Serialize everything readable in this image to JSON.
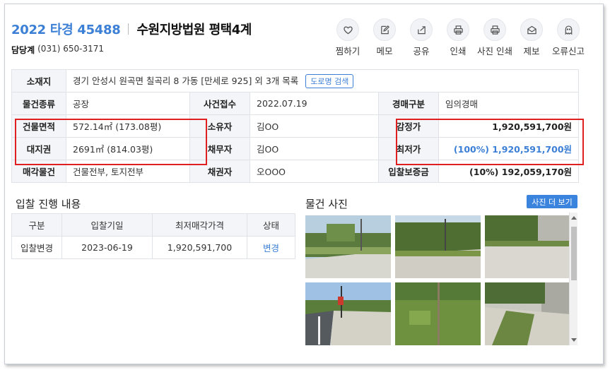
{
  "header": {
    "case_no": "2022 타경 45488",
    "court": "수원지방법원 평택4계",
    "dept_label": "담당계",
    "phone": "(031) 650-3171"
  },
  "actions": [
    {
      "label": "찜하기",
      "icon": "heart-icon"
    },
    {
      "label": "메모",
      "icon": "memo-icon"
    },
    {
      "label": "공유",
      "icon": "share-icon"
    },
    {
      "label": "인쇄",
      "icon": "print-icon"
    },
    {
      "label": "사진 인쇄",
      "icon": "photo-print-icon"
    },
    {
      "label": "제보",
      "icon": "report-icon"
    },
    {
      "label": "오류신고",
      "icon": "error-report-icon"
    }
  ],
  "info": {
    "location_label": "소재지",
    "location_value": "경기 안성시 원곡면 칠곡리 8 가동 [만세로 925] 외 3개 목록",
    "road_search": "도로명 검색",
    "type_label": "물건종류",
    "type_value": "공장",
    "case_recv_label": "사건접수",
    "case_recv_value": "2022.07.19",
    "auction_type_label": "경매구분",
    "auction_type_value": "임의경매",
    "bldg_area_label": "건물면적",
    "bldg_area_value": "572.14㎡ (173.08평)",
    "owner_label": "소유자",
    "owner_value": "김OO",
    "appraisal_label": "감정가",
    "appraisal_value": "1,920,591,700원",
    "land_label": "대지권",
    "land_value": "2691㎡ (814.03평)",
    "debtor_label": "채무자",
    "debtor_value": "김OO",
    "min_price_label": "최저가",
    "min_price_value": "(100%) 1,920,591,700원",
    "sale_item_label": "매각물건",
    "sale_item_value": "건물전부, 토지전부",
    "creditor_label": "채권자",
    "creditor_value": "오OOO",
    "deposit_label": "입찰보증금",
    "deposit_value": "(10%) 192,059,170원"
  },
  "bid": {
    "title": "입찰 진행 내용",
    "headers": [
      "구분",
      "입찰기일",
      "최저매각가격",
      "상태"
    ],
    "row": [
      "입찰변경",
      "2023-06-19",
      "1,920,591,700",
      "변경"
    ]
  },
  "photos": {
    "title": "물건 사진",
    "more": "사진 더 보기"
  }
}
